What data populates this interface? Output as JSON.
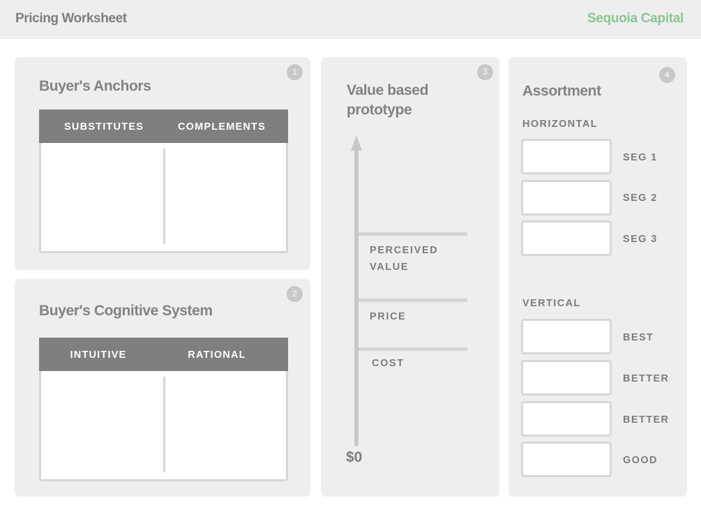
{
  "header": {
    "title": "Pricing Worksheet",
    "brand": "Sequoia Capital"
  },
  "panels": {
    "anchors": {
      "number": "1",
      "title": "Buyer's Anchors",
      "columns": [
        "SUBSTITUTES",
        "COMPLEMENTS"
      ]
    },
    "cognitive": {
      "number": "2",
      "title": "Buyer's Cognitive System",
      "columns": [
        "INTUITIVE",
        "RATIONAL"
      ]
    },
    "prototype": {
      "number": "3",
      "title_line1": "Value based",
      "title_line2": "prototype",
      "levels": [
        {
          "line1": "PERCEIVED",
          "line2": "VALUE"
        },
        {
          "line1": "PRICE",
          "line2": ""
        },
        {
          "line1": "COST",
          "line2": ""
        }
      ],
      "base_label": "$0"
    },
    "assortment": {
      "number": "4",
      "title": "Assortment",
      "horizontal": {
        "label": "HORIZONTAL",
        "items": [
          "SEG 1",
          "SEG 2",
          "SEG 3"
        ]
      },
      "vertical": {
        "label": "VERTICAL",
        "items": [
          "BEST",
          "BETTER",
          "BETTER",
          "GOOD"
        ]
      }
    }
  }
}
